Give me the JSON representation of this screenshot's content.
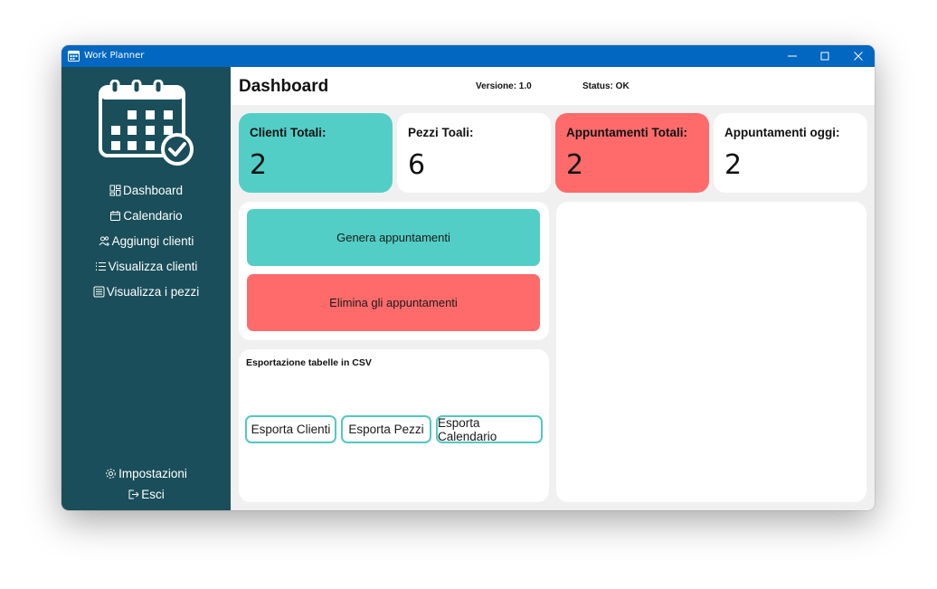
{
  "window": {
    "title": "Work Planner",
    "controls": {
      "minimize": "minimize-icon",
      "maximize": "maximize-icon",
      "close": "close-icon"
    }
  },
  "sidebar": {
    "logo_icon": "calendar-check-icon",
    "items": [
      {
        "label": "Dashboard",
        "icon": "dashboard-icon"
      },
      {
        "label": "Calendario",
        "icon": "calendar-icon"
      },
      {
        "label": "Aggiungi clienti",
        "icon": "users-add-icon"
      },
      {
        "label": "Visualizza clienti",
        "icon": "list-icon"
      },
      {
        "label": "Visualizza i pezzi",
        "icon": "list-box-icon"
      }
    ],
    "footer": [
      {
        "label": "Impostazioni",
        "icon": "gear-icon"
      },
      {
        "label": "Esci",
        "icon": "logout-icon"
      }
    ]
  },
  "header": {
    "title": "Dashboard",
    "version": "Versione: 1.0",
    "status": "Status: OK"
  },
  "stats": [
    {
      "label": "Clienti Totali:",
      "value": "2",
      "color": "#52cec6"
    },
    {
      "label": "Pezzi Toali:",
      "value": "6",
      "color": "#ffffff"
    },
    {
      "label": "Appuntamenti Totali:",
      "value": "2",
      "color": "#ff6b6b"
    },
    {
      "label": "Appuntamenti oggi:",
      "value": "2",
      "color": "#ffffff"
    }
  ],
  "actions": {
    "generate": "Genera appuntamenti",
    "delete": "Elimina gli appuntamenti"
  },
  "export": {
    "title": "Esportazione tabelle in CSV",
    "buttons": [
      "Esporta Clienti",
      "Esporta Pezzi",
      "Esporta Calendario"
    ]
  },
  "colors": {
    "sidebar": "#1a4e5a",
    "titlebar": "#0167c0",
    "accent_teal": "#52cec6",
    "accent_red": "#ff6b6b",
    "background": "#f0f0f0"
  }
}
